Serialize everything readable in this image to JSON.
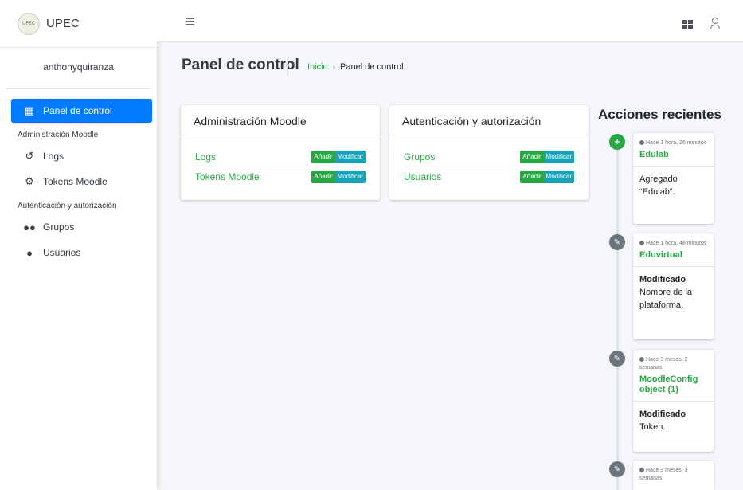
{
  "brand": {
    "name": "UPEC",
    "logo_text": "UPEC"
  },
  "user": {
    "name": "anthonyquiranza"
  },
  "sidebar": {
    "dashboard": "Panel de control",
    "section_moodle": "Administración Moodle",
    "logs": "Logs",
    "tokens": "Tokens Moodle",
    "section_auth": "Autenticación y autorización",
    "groups": "Grupos",
    "users": "Usuarios"
  },
  "header": {
    "title": "Panel de control",
    "breadcrumb_home": "Inicio",
    "breadcrumb_sep": "›",
    "breadcrumb_current": "Panel de control"
  },
  "apps": [
    {
      "title": "Administración Moodle",
      "models": [
        {
          "name": "Logs",
          "add": "Añadir",
          "edit": "Modificar"
        },
        {
          "name": "Tokens Moodle",
          "add": "Añadir",
          "edit": "Modificar"
        }
      ]
    },
    {
      "title": "Autenticación y autorización",
      "models": [
        {
          "name": "Grupos",
          "add": "Añadir",
          "edit": "Modificar"
        },
        {
          "name": "Usuarios",
          "add": "Añadir",
          "edit": "Modificar"
        }
      ]
    }
  ],
  "recent": {
    "title": "Acciones recientes",
    "items": [
      {
        "time": "Hace 1 hora, 26 minutos",
        "object": "Edulab",
        "action": "",
        "detail": "Agregado “Edulab”."
      },
      {
        "time": "Hace 1 hora, 48 minutos",
        "object": "Eduvirtual",
        "action": "Modificado",
        "detail": "Nombre de la plataforma."
      },
      {
        "time": "Hace 3 meses, 2 semanas",
        "object": "MoodleConfig object (1)",
        "action": "Modificado",
        "detail": "Token."
      },
      {
        "time": "Hace 3 meses, 3 semanas",
        "object": "",
        "action": "",
        "detail": ""
      }
    ]
  },
  "colors": {
    "primary": "#007bff",
    "success": "#28a745",
    "info": "#17a2b8",
    "secondary": "#6c757d"
  },
  "icons": {
    "menu": "hamburger-icon",
    "apps": "grid-icon",
    "user": "user-icon"
  }
}
